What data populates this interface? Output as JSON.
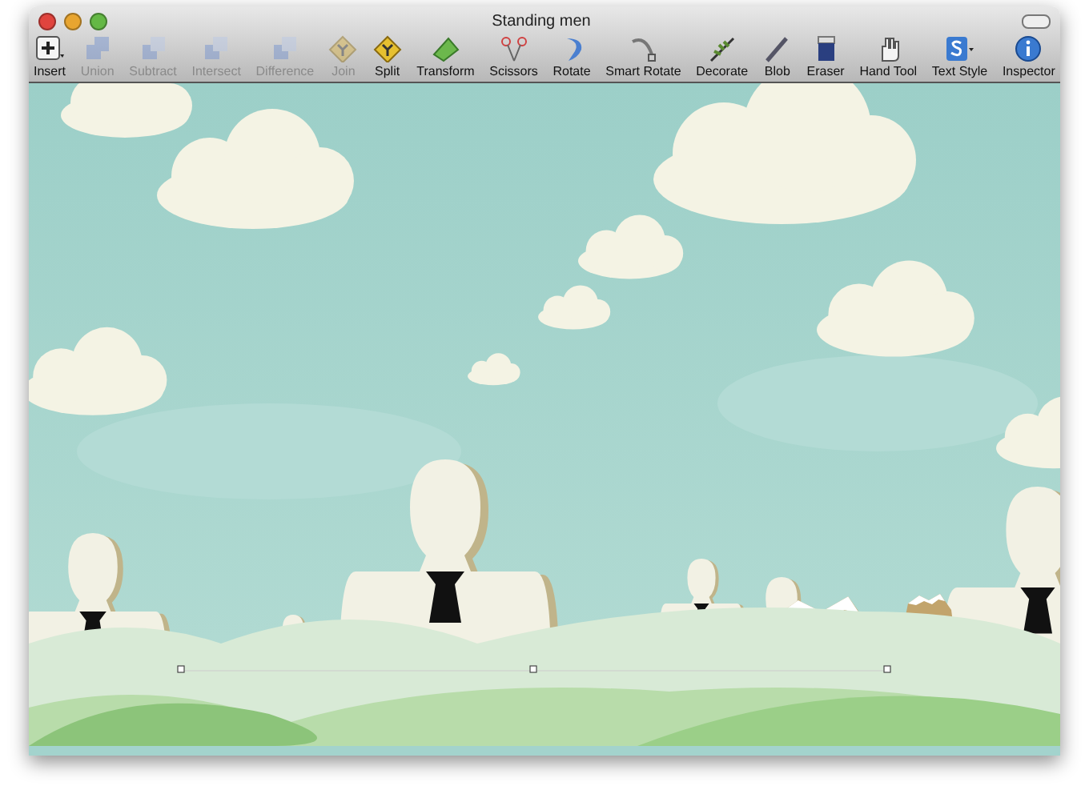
{
  "window": {
    "title": "Standing men"
  },
  "toolbar": [
    {
      "label": "Insert",
      "disabled": false
    },
    {
      "label": "Union",
      "disabled": true
    },
    {
      "label": "Subtract",
      "disabled": true
    },
    {
      "label": "Intersect",
      "disabled": true
    },
    {
      "label": "Difference",
      "disabled": true
    },
    {
      "label": "Join",
      "disabled": true
    },
    {
      "label": "Split",
      "disabled": false
    },
    {
      "label": "Transform",
      "disabled": false
    },
    {
      "label": "Scissors",
      "disabled": false
    },
    {
      "label": "Rotate",
      "disabled": false
    },
    {
      "label": "Smart Rotate",
      "disabled": false
    },
    {
      "label": "Decorate",
      "disabled": false
    },
    {
      "label": "Blob",
      "disabled": false
    },
    {
      "label": "Eraser",
      "disabled": false
    },
    {
      "label": "Hand Tool",
      "disabled": false
    },
    {
      "label": "Text Style",
      "disabled": false
    },
    {
      "label": "Inspector",
      "disabled": false
    }
  ]
}
